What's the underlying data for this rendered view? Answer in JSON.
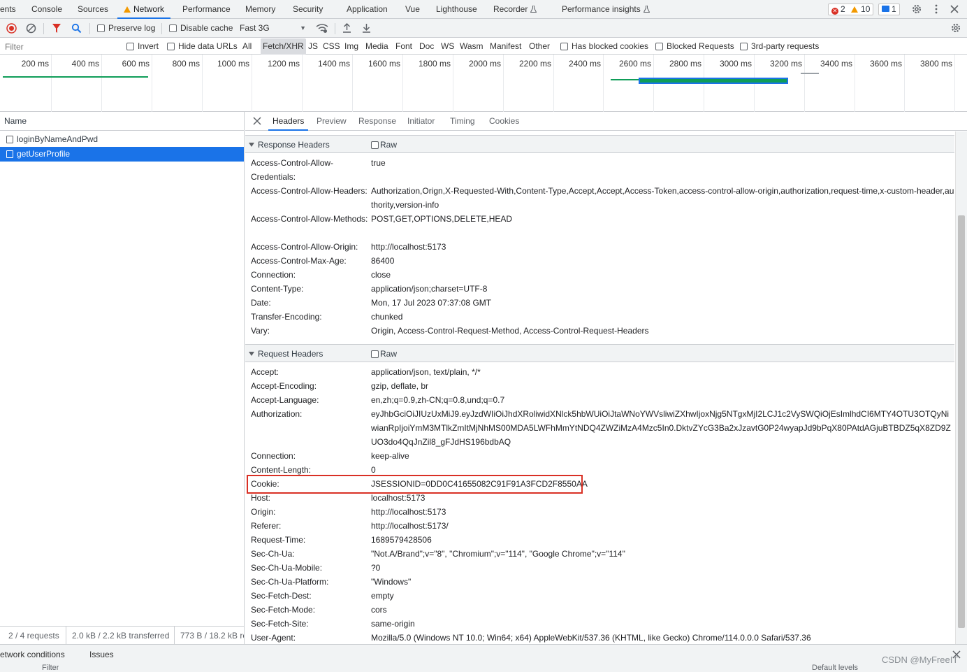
{
  "top_tabs": [
    "ents",
    "Console",
    "Sources",
    "Network",
    "Performance",
    "Memory",
    "Security",
    "Application",
    "Vue",
    "Lighthouse",
    "Recorder",
    "Performance insights"
  ],
  "top_badges": {
    "errors": "2",
    "warnings": "10",
    "messages": "1"
  },
  "toolbar": {
    "preserve_log": "Preserve log",
    "disable_cache": "Disable cache",
    "throttle": "Fast 3G"
  },
  "filter": {
    "placeholder": "Filter",
    "invert": "Invert",
    "hide_data_urls": "Hide data URLs",
    "types": [
      "All",
      "Fetch/XHR",
      "JS",
      "CSS",
      "Img",
      "Media",
      "Font",
      "Doc",
      "WS",
      "Wasm",
      "Manifest",
      "Other"
    ],
    "selected_type": "Fetch/XHR",
    "has_blocked_cookies": "Has blocked cookies",
    "blocked_requests": "Blocked Requests",
    "third_party": "3rd-party requests"
  },
  "timeline_ticks": [
    "200 ms",
    "400 ms",
    "600 ms",
    "800 ms",
    "1000 ms",
    "1200 ms",
    "1400 ms",
    "1600 ms",
    "1800 ms",
    "2000 ms",
    "2200 ms",
    "2400 ms",
    "2600 ms",
    "2800 ms",
    "3000 ms",
    "3200 ms",
    "3400 ms",
    "3600 ms",
    "3800 ms"
  ],
  "name_column": "Name",
  "requests": [
    {
      "name": "loginByNameAndPwd",
      "selected": false
    },
    {
      "name": "getUserProfile",
      "selected": true
    }
  ],
  "status": {
    "requests": "2 / 4 requests",
    "transferred": "2.0 kB / 2.2 kB transferred",
    "resources": "773 B / 18.2 kB re"
  },
  "detail_tabs": [
    "Headers",
    "Preview",
    "Response",
    "Initiator",
    "Timing",
    "Cookies"
  ],
  "response_headers": {
    "title": "Response Headers",
    "raw": "Raw",
    "items": [
      {
        "k": "Access-Control-Allow-Credentials:",
        "v": "true"
      },
      {
        "k": "Access-Control-Allow-Headers:",
        "v": "Authorization,Orign,X-Requested-With,Content-Type,Accept,Accept,Access-Token,access-control-allow-origin,authorization,request-time,x-custom-header,authority,version-info"
      },
      {
        "k": "Access-Control-Allow-Methods:",
        "v": "POST,GET,OPTIONS,DELETE,HEAD"
      },
      {
        "k": "Access-Control-Allow-Origin:",
        "v": "http://localhost:5173"
      },
      {
        "k": "Access-Control-Max-Age:",
        "v": "86400"
      },
      {
        "k": "Connection:",
        "v": "close"
      },
      {
        "k": "Content-Type:",
        "v": "application/json;charset=UTF-8"
      },
      {
        "k": "Date:",
        "v": "Mon, 17 Jul 2023 07:37:08 GMT"
      },
      {
        "k": "Transfer-Encoding:",
        "v": "chunked"
      },
      {
        "k": "Vary:",
        "v": "Origin, Access-Control-Request-Method, Access-Control-Request-Headers"
      }
    ]
  },
  "request_headers": {
    "title": "Request Headers",
    "raw": "Raw",
    "items": [
      {
        "k": "Accept:",
        "v": "application/json, text/plain, */*"
      },
      {
        "k": "Accept-Encoding:",
        "v": "gzip, deflate, br"
      },
      {
        "k": "Accept-Language:",
        "v": "en,zh;q=0.9,zh-CN;q=0.8,und;q=0.7"
      },
      {
        "k": "Authorization:",
        "v": "eyJhbGciOiJIUzUxMiJ9.eyJzdWIiOiJhdXRoliwidXNlck5hbWUiOiJtaWNoYWVsliwiZXhwIjoxNjg5NTgxMjI2LCJ1c2VySWQiOjEsImlhdCI6MTY4OTU3OTQyNiwianRpIjoiYmM3MTlkZmItMjNhMS00MDA5LWFhMmYtNDQ4ZWZiMzA4Mzc5In0.DktvZYcG3Ba2xJzavtG0P24wyapJd9bPqX80PAtdAGjuBTBDZ5qX8ZD9ZUO3do4QqJnZil8_gFJdHS196bdbAQ"
      },
      {
        "k": "Connection:",
        "v": "keep-alive"
      },
      {
        "k": "Content-Length:",
        "v": "0"
      },
      {
        "k": "Cookie:",
        "v": "JSESSIONID=0DD0C41655082C91F91A3FCD2F8550AA"
      },
      {
        "k": "Host:",
        "v": "localhost:5173"
      },
      {
        "k": "Origin:",
        "v": "http://localhost:5173"
      },
      {
        "k": "Referer:",
        "v": "http://localhost:5173/"
      },
      {
        "k": "Request-Time:",
        "v": "1689579428506"
      },
      {
        "k": "Sec-Ch-Ua:",
        "v": "\"Not.A/Brand\";v=\"8\", \"Chromium\";v=\"114\", \"Google Chrome\";v=\"114\""
      },
      {
        "k": "Sec-Ch-Ua-Mobile:",
        "v": "?0"
      },
      {
        "k": "Sec-Ch-Ua-Platform:",
        "v": "\"Windows\""
      },
      {
        "k": "Sec-Fetch-Dest:",
        "v": "empty"
      },
      {
        "k": "Sec-Fetch-Mode:",
        "v": "cors"
      },
      {
        "k": "Sec-Fetch-Site:",
        "v": "same-origin"
      },
      {
        "k": "User-Agent:",
        "v": "Mozilla/5.0 (Windows NT 10.0; Win64; x64) AppleWebKit/537.36 (KHTML, like Gecko) Chrome/114.0.0.0 Safari/537.36"
      }
    ]
  },
  "drawer": {
    "tabs": [
      "etwork conditions",
      "Issues"
    ],
    "filter_placeholder": "Filter",
    "levels": "Default levels"
  },
  "watermark": "CSDN @MyFreeIT",
  "colors": {
    "accent": "#1a73e8",
    "highlight_box": "#d93025",
    "waterfall_green": "#0f9d58"
  }
}
